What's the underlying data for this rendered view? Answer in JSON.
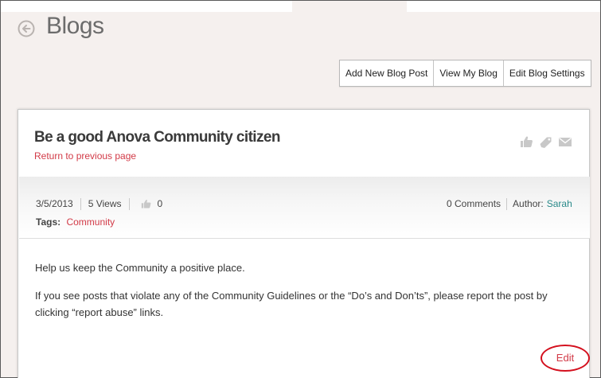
{
  "page": {
    "title": "Blogs"
  },
  "toolbar": {
    "buttons": [
      {
        "label": "Add New Blog Post"
      },
      {
        "label": "View My Blog"
      },
      {
        "label": "Edit Blog Settings"
      }
    ]
  },
  "post": {
    "title": "Be a good Anova Community citizen",
    "return_link": "Return to previous page",
    "date": "3/5/2013",
    "views": "5 Views",
    "likes": "0",
    "comments": "0 Comments",
    "author_label": "Author:",
    "author": "Sarah",
    "tags_label": "Tags:",
    "tag": "Community",
    "body": [
      "Help us keep the Community a positive place.",
      "If you see posts that violate any of the Community Guidelines or the “Do’s and Don’ts”, please report the post by clicking “report abuse” links."
    ],
    "edit_label": "Edit"
  },
  "icons": {
    "back": "back-arrow-circle-icon",
    "like": "thumbs-up-icon",
    "tag": "tag-icon",
    "email": "envelope-icon"
  },
  "colors": {
    "background": "#f5f0ee",
    "link_red": "#d23a47",
    "author_teal": "#2a8a8a",
    "edit_highlight": "#d4101e"
  }
}
